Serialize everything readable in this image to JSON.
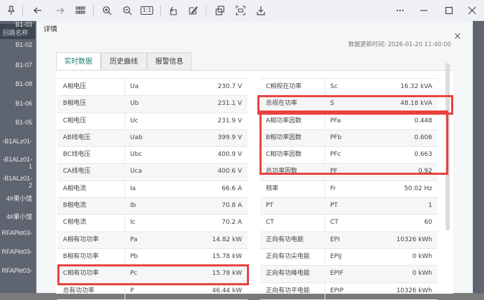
{
  "toolbar": {
    "zoom_label": "1:1",
    "icons": [
      "pin-icon",
      "back-icon",
      "forward-icon",
      "grid-icon",
      "zoom-in-icon",
      "zoom-out-icon",
      "actual-size-icon",
      "rotate-icon",
      "edit-icon",
      "copy-icon",
      "scan-icon",
      "download-icon",
      "more-icon",
      "minimize-icon",
      "maximize-icon",
      "close-icon"
    ]
  },
  "background": {
    "header": "回路名称",
    "labels": [
      "B1-03",
      "B1-02",
      "B1-07",
      "B1-08",
      "B1-06",
      "B1-05",
      "-B1ALz01-",
      "-B1ALz01-1",
      "-B1ALz01-2",
      "4#果小馆",
      "4#果小馆",
      "RFAPkt03-",
      "RFAPkt03-",
      "RFAPkt03-"
    ]
  },
  "modal": {
    "title": "详情",
    "close_glyph": "×",
    "updated_label": "数据更新时间:",
    "updated_time": "2026-01-20 11:40:00",
    "tabs": [
      {
        "label": "实时数据"
      },
      {
        "label": "历史曲线"
      },
      {
        "label": "报警信息"
      }
    ],
    "left_rows": [
      {
        "name": "A相电压",
        "code": "Ua",
        "value": "230.7 V"
      },
      {
        "name": "B相电压",
        "code": "Ub",
        "value": "231.1 V"
      },
      {
        "name": "C相电压",
        "code": "Uc",
        "value": "231.9 V"
      },
      {
        "name": "AB线电压",
        "code": "Uab",
        "value": "399.9 V"
      },
      {
        "name": "BC线电压",
        "code": "Ubc",
        "value": "400.9 V"
      },
      {
        "name": "CA线电压",
        "code": "Uca",
        "value": "400.6 V"
      },
      {
        "name": "A相电流",
        "code": "Ia",
        "value": "66.6 A"
      },
      {
        "name": "B相电流",
        "code": "Ib",
        "value": "70.8 A"
      },
      {
        "name": "C相电流",
        "code": "Ic",
        "value": "70.2 A"
      },
      {
        "name": "A相有功功率",
        "code": "Pa",
        "value": "14.82 kW"
      },
      {
        "name": "B相有功功率",
        "code": "Pb",
        "value": "15.78 kW"
      },
      {
        "name": "C相有功功率",
        "code": "Pc",
        "value": "15.78 kW"
      },
      {
        "name": "总有功功率",
        "code": "P",
        "value": "46.44 kW"
      }
    ],
    "right_rows": [
      {
        "name": "C相视在功率",
        "code": "Sc",
        "value": "16.32 kVA"
      },
      {
        "name": "总视在功率",
        "code": "S",
        "value": "48.18 kVA"
      },
      {
        "name": "A相功率因数",
        "code": "PFa",
        "value": "0.448"
      },
      {
        "name": "B相功率因数",
        "code": "PFb",
        "value": "0.606"
      },
      {
        "name": "C相功率因数",
        "code": "PFc",
        "value": "0.663"
      },
      {
        "name": "总功率因数",
        "code": "PF",
        "value": "0.92"
      },
      {
        "name": "频率",
        "code": "Fr",
        "value": "50.02 Hz"
      },
      {
        "name": "PT",
        "code": "PT",
        "value": "1"
      },
      {
        "name": "CT",
        "code": "CT",
        "value": "60"
      },
      {
        "name": "正向有功电能",
        "code": "EPI",
        "value": "10326 kWh"
      },
      {
        "name": "正向有功尖电能",
        "code": "EPIJ",
        "value": "0 kWh"
      },
      {
        "name": "正向有功峰电能",
        "code": "EPIF",
        "value": "0 kWh"
      },
      {
        "name": "正向有功平电能",
        "code": "EPIP",
        "value": "10326 kWh"
      }
    ]
  },
  "colors": {
    "highlight": "#e8423f",
    "active_tab": "#1f7a6a"
  }
}
